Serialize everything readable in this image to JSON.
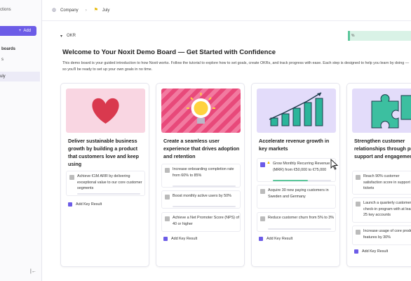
{
  "sidebar": {
    "top_label": "ctions",
    "add_label": "Add",
    "section_label": "boards",
    "item_label": "s",
    "active_label": "uly",
    "collapse_icon": "|←"
  },
  "breadcrumb": {
    "company": "Company",
    "period": "July"
  },
  "okr": {
    "label": "OKR",
    "progress": "%"
  },
  "headline": "Welcome to Your Noxit Demo Board — Get Started with Confidence",
  "intro": "This demo board is your guided introduction to how Noxit works. Follow the tutorial to explore how to set goals, create OKRs, and track progress with ease. Each step is designed to help you learn by doing — so you'll be ready to set up your own goals in no time.",
  "add_kr_label": "Add Key Result",
  "cards": [
    {
      "title": "Deliver sustainable business growth by building a product that customers love and keep using",
      "image": "heart",
      "key_results": [
        {
          "text": "Achieve €1M ARR by delivering exceptional value to our core customer segments",
          "progress": 0.0
        }
      ]
    },
    {
      "title": "Create a seamless user experience that drives adoption and retention",
      "image": "lightbulb",
      "key_results": [
        {
          "text": "Increase onboarding completion rate from 60% to 85%",
          "progress": 0.0
        },
        {
          "text": "Boost monthly active users by 50%",
          "progress": 0.0
        },
        {
          "text": "Achieve a Net Promoter Score (NPS) of 40 or higher",
          "progress": 0.0
        }
      ]
    },
    {
      "title": "Accelerate revenue growth in key markets",
      "image": "bar-chart",
      "key_results": [
        {
          "text": "Grow Monthly Recurring Revenue (MRR) from €50,000 to €75,000",
          "progress": 0.6
        },
        {
          "text": "Acquire 30 new paying customers in Sweden and Germany",
          "progress": 0.0
        },
        {
          "text": "Reduce customer churn from 5% to 3%",
          "progress": 0.0
        }
      ]
    },
    {
      "title": "Strengthen customer relationships through proactive support and engagement",
      "image": "puzzle",
      "key_results": [
        {
          "text": "Reach 90% customer satisfaction score in support tickets",
          "progress": 0.0
        },
        {
          "text": "Launch a quarterly customer check-in program with at least 25 key accounts",
          "progress": 0.0
        },
        {
          "text": "Increase usage of core product features by 30%",
          "progress": 0.0
        }
      ]
    }
  ],
  "colors": {
    "accent": "#6c5ce7",
    "progress": "#5cc79b"
  }
}
